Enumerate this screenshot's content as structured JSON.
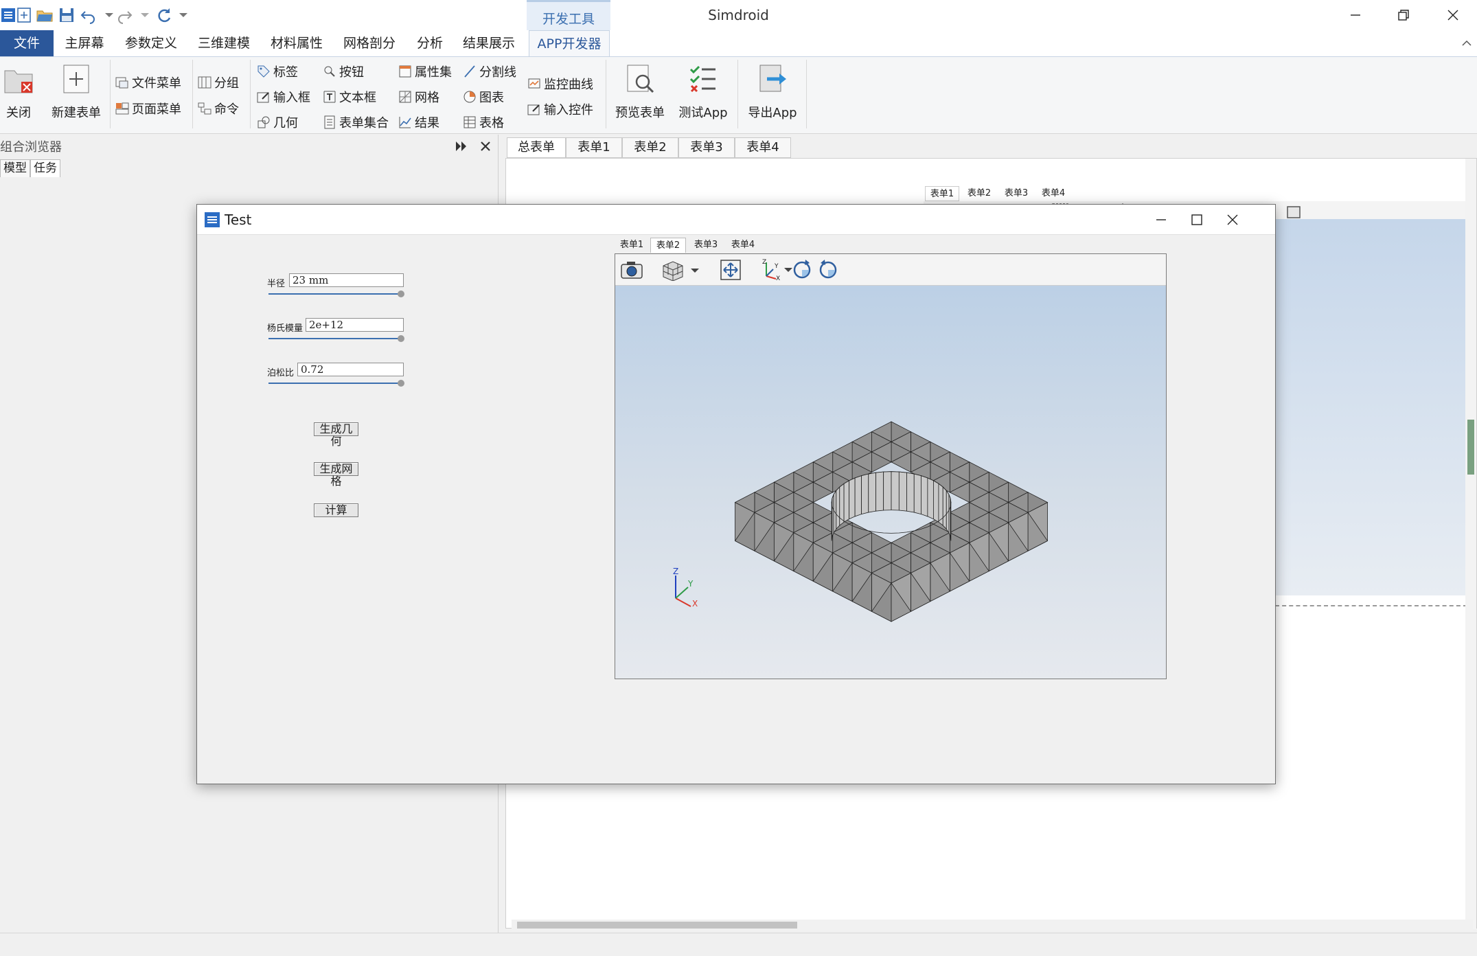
{
  "app": {
    "title": "Simdroid",
    "context_tab": "开发工具"
  },
  "menu": {
    "file": "文件",
    "items": [
      "主屏幕",
      "参数定义",
      "三维建模",
      "材料属性",
      "网格剖分",
      "分析",
      "结果展示",
      "APP开发器"
    ]
  },
  "ribbon": {
    "close": "关闭",
    "new_form": "新建表单",
    "file_menu": "文件菜单",
    "page_menu": "页面菜单",
    "group": "分组",
    "command": "命令",
    "label": "标签",
    "input_box": "输入框",
    "geometry": "几何",
    "button": "按钮",
    "textbox": "文本框",
    "form_set": "表单集合",
    "property_set": "属性集",
    "mesh": "网格",
    "result": "结果",
    "divider": "分割线",
    "chart": "图表",
    "table": "表格",
    "monitor_curve": "监控曲线",
    "input_control": "输入控件",
    "preview_form": "预览表单",
    "test_app": "测试App",
    "export_app": "导出App"
  },
  "browser": {
    "title": "组合浏览器",
    "tabs": [
      "模型",
      "任务"
    ]
  },
  "editor": {
    "tabs": [
      "总表单",
      "表单1",
      "表单2",
      "表单3",
      "表单4"
    ],
    "mini_tabs": [
      "表单1",
      "表单2",
      "表单3",
      "表单4"
    ]
  },
  "dialog": {
    "title": "Test",
    "fields": [
      {
        "label": "半径",
        "value": "23 mm"
      },
      {
        "label": "杨氏模量",
        "value": "2e+12"
      },
      {
        "label": "泊松比",
        "value": "0.72"
      }
    ],
    "buttons": [
      "生成几何",
      "生成网格",
      "计算"
    ],
    "view_tabs": [
      "表单1",
      "表单2",
      "表单3",
      "表单4"
    ],
    "active_view_tab": "表单2"
  },
  "colors": {
    "accent": "#2b579a",
    "mesh_face": "#8c8c8c",
    "mesh_inner": "#c9c9c9",
    "viewport_top": "#bcd0e6",
    "viewport_bottom": "#e6e9ee"
  }
}
